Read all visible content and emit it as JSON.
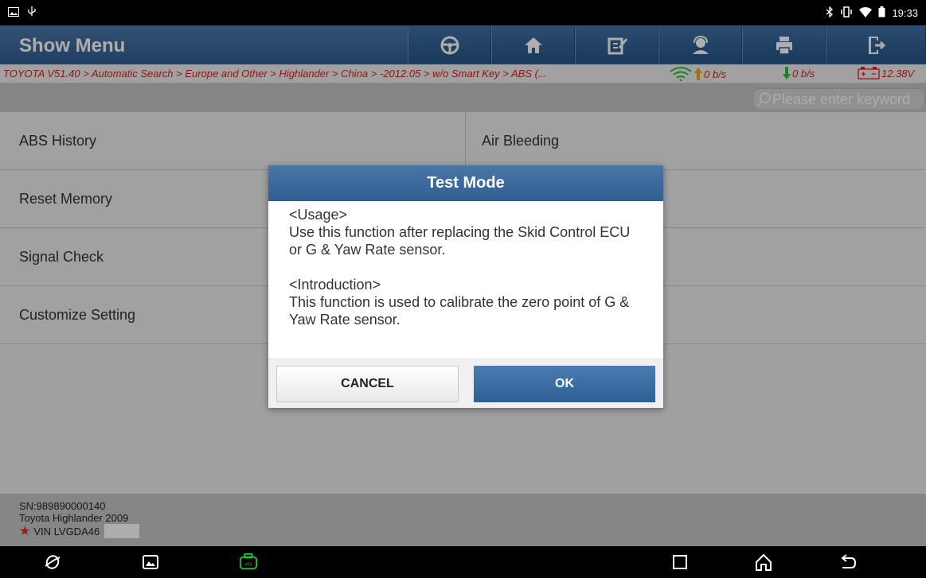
{
  "status_bar": {
    "time": "19:33",
    "icons": [
      "image-icon",
      "usb-icon",
      "bluetooth-icon",
      "vibrate-icon",
      "wifi-icon",
      "battery-icon"
    ]
  },
  "header": {
    "title": "Show Menu",
    "toolbar": [
      "steering-wheel-icon",
      "home-icon",
      "edit-icon",
      "support-icon",
      "print-icon",
      "exit-icon"
    ]
  },
  "breadcrumb": {
    "path": "TOYOTA V51.40 > Automatic Search > Europe and Other > Highlander > China > -2012.05 > w/o Smart Key > ABS (...",
    "upload": "0 b/s",
    "download": "0 b/s",
    "voltage": "12.38V"
  },
  "search": {
    "placeholder": "Please enter keyword"
  },
  "menu": {
    "items": [
      "ABS History",
      "Air Bleeding",
      "Reset Memory",
      "",
      "Signal Check",
      "",
      "Customize Setting",
      ""
    ]
  },
  "footer": {
    "sn": "SN:989890000140",
    "vehicle": "Toyota Highlander 2009",
    "vin": "VIN LVGDA46"
  },
  "dialog": {
    "title": "Test Mode",
    "usage_header": "<Usage>",
    "usage_text": "Use this function after replacing the Skid Control ECU or G & Yaw Rate sensor.",
    "intro_header": "<Introduction>",
    "intro_text": "This function is used to calibrate the zero point of G & Yaw Rate sensor.",
    "cancel_label": "CANCEL",
    "ok_label": "OK"
  },
  "colors": {
    "accent": "#305f93",
    "breadcrumb": "#d81e1e",
    "vci_green": "#2bbf3a"
  }
}
